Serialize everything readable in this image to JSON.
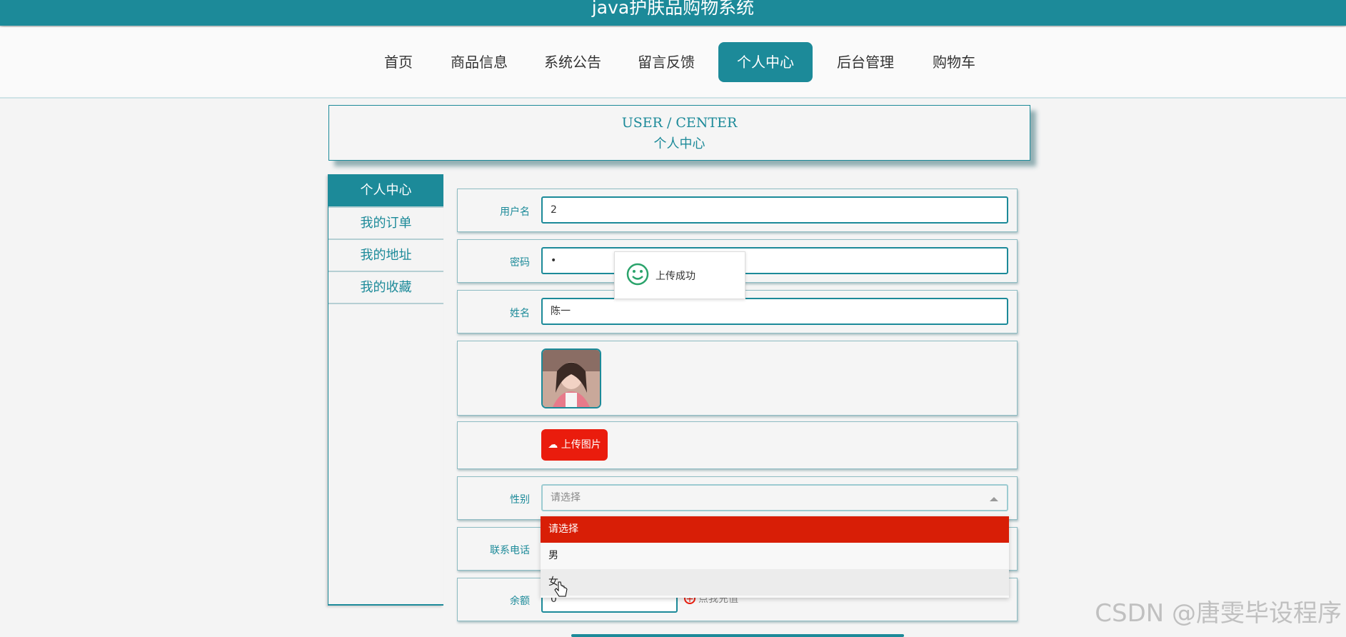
{
  "app": {
    "title": "java护肤品购物系统"
  },
  "nav": {
    "items": [
      {
        "label": "首页"
      },
      {
        "label": "商品信息"
      },
      {
        "label": "系统公告"
      },
      {
        "label": "留言反馈"
      },
      {
        "label": "个人中心",
        "active": true
      },
      {
        "label": "后台管理"
      },
      {
        "label": "购物车"
      }
    ]
  },
  "header": {
    "en": "USER / CENTER",
    "cn": "个人中心"
  },
  "sidebar": {
    "items": [
      {
        "label": "个人中心",
        "active": true
      },
      {
        "label": "我的订单"
      },
      {
        "label": "我的地址"
      },
      {
        "label": "我的收藏"
      }
    ]
  },
  "form": {
    "username": {
      "label": "用户名",
      "value": "2"
    },
    "password": {
      "label": "密码",
      "value": "•"
    },
    "name": {
      "label": "姓名",
      "value": "陈一"
    },
    "upload": {
      "label": "上传图片"
    },
    "gender": {
      "label": "性别",
      "placeholder": "请选择",
      "options": [
        "请选择",
        "男",
        "女"
      ]
    },
    "phone": {
      "label": "联系电话"
    },
    "balance": {
      "label": "余额",
      "value": "0",
      "recharge": "点我充值"
    }
  },
  "toast": {
    "text": "上传成功"
  },
  "watermark": "CSDN @唐雯毕设程序",
  "colors": {
    "accent": "#1c8a99",
    "danger": "#ea1c0d"
  }
}
